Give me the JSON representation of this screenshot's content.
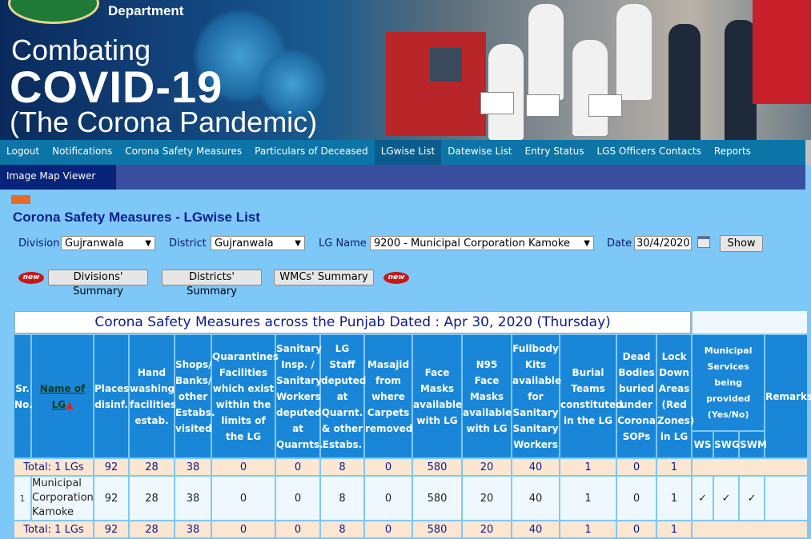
{
  "banner": {
    "department": "Department",
    "line1": "Combating",
    "line2": "COVID-19",
    "line3": "(The Corona Pandemic)"
  },
  "nav": {
    "items": [
      "Logout",
      "Notifications",
      "Corona Safety Measures",
      "Particulars of Deceased",
      "LGwise List",
      "Datewise List",
      "Entry Status",
      "LGS Officers Contacts",
      "Reports"
    ],
    "active": "LGwise List",
    "secondary": "Image Map Viewer"
  },
  "page": {
    "title": "Corona Safety Measures - LGwise List"
  },
  "filters": {
    "division_label": "Division",
    "division_value": "Gujranwala",
    "district_label": "District",
    "district_value": "Gujranwala",
    "lg_label": "LG Name",
    "lg_value": "9200 - Municipal Corporation Kamoke",
    "date_label": "Date",
    "date_value": "30/4/2020",
    "show_label": "Show"
  },
  "summary_buttons": {
    "new_badge": "new",
    "divisions": "Divisions' Summary",
    "districts": "Districts' Summary",
    "wmcs": "WMCs' Summary"
  },
  "table": {
    "caption": "Corona Safety Measures across the Punjab Dated : Apr 30, 2020 (Thursday)",
    "headers": {
      "sr": "Sr. No.",
      "name": "Name of LG",
      "places": "Places disinf.",
      "hand": "Hand washing facilities estab.",
      "shops": "Shops/ Banks/ other Estabs. visited",
      "quarantines": "Quarantines Facilities which exist within the limits of the LG",
      "sanitary": "Sanitary Insp. / Sanitary Workers deputed at Quarnts.",
      "lgstaff": "LG Staff deputed at Quarnt. & other Estabs.",
      "masajid": "Masajid from where Carpets removed",
      "face": "Face Masks available with LG",
      "n95": "N95 Face Masks available with LG",
      "fullbody": "Fullbody Kits available for Sanitary Sanitary Workers",
      "burial": "Burial Teams constituted in the LG",
      "dead": "Dead Bodies buried under Corona SOPs",
      "lockdown": "Lock Down Areas (Red Zones) in LG",
      "municipal": "Municipal Services being provided (Yes/No)",
      "ws": "WS",
      "swg": "SWG",
      "swm": "SWM",
      "remarks": "Remarks"
    },
    "total_label": "Total: 1 LGs",
    "totals": [
      "92",
      "28",
      "38",
      "0",
      "0",
      "8",
      "0",
      "580",
      "20",
      "40",
      "1",
      "0",
      "1"
    ],
    "rows": [
      {
        "sr": "1",
        "name": "Municipal Corporation Kamoke",
        "values": [
          "92",
          "28",
          "38",
          "0",
          "0",
          "8",
          "0",
          "580",
          "20",
          "40",
          "1",
          "0",
          "1"
        ],
        "ws": "✓",
        "swg": "✓",
        "swm": "✓",
        "remarks": ""
      }
    ]
  },
  "colors": {
    "nav": "#0c74a6",
    "header": "#1a86d8",
    "total_bg": "#fbe6d2",
    "page_bg": "#7ec8f8"
  }
}
